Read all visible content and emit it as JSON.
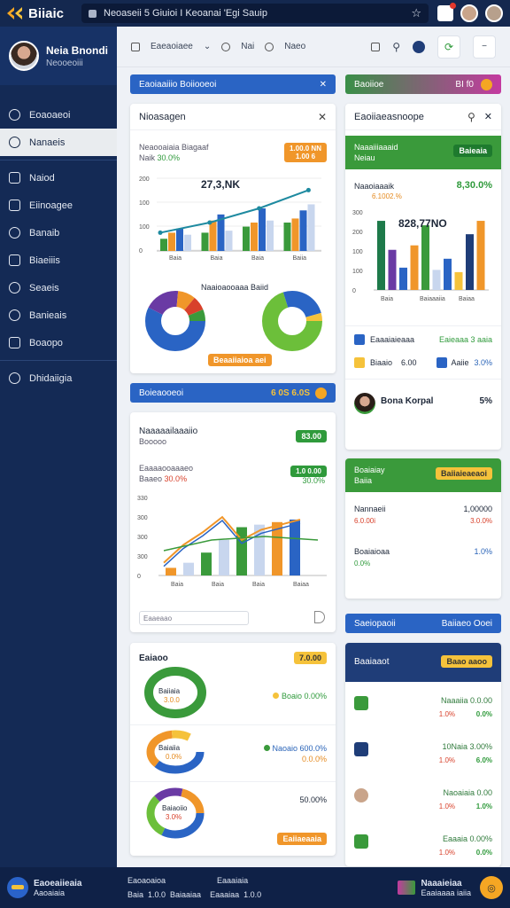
{
  "app": {
    "title": "Biiaic"
  },
  "urlbar": {
    "text": "Neoaseii 5 Giuioi I Keoanai 'Egi Sauip"
  },
  "profile": {
    "name": "Neia Bnondi",
    "sub": "Neooeoiii"
  },
  "sidebar": {
    "items": [
      {
        "label": "Eoaoaeoi"
      },
      {
        "label": "Nanaeis"
      },
      {
        "label": "Naiod"
      },
      {
        "label": "Eiinoagee"
      },
      {
        "label": "Banaib"
      },
      {
        "label": "Biaeiiis"
      },
      {
        "label": "Seaeis"
      },
      {
        "label": "Banieais"
      },
      {
        "label": "Boaopo"
      },
      {
        "label": "Dhidaiigia"
      }
    ]
  },
  "toolbar": {
    "label1": "Eaeaoiaee",
    "label2": "Nai",
    "label3": "Naeo"
  },
  "banners": {
    "blue_top": "Eaoiaaiiio Boiiooeoi",
    "pink_top": "Baoiioe",
    "pink_vals": "BI  f0",
    "blue_mid": "Boieaooeoi",
    "blue_mid_val": "6 0S 6.0S",
    "blue_right": "Saeiopaoii",
    "blue_right_val": "Baiiaeo Ooei"
  },
  "card1": {
    "title": "Nioasagen",
    "subtitle": "Neaooaiaia Biagaaf",
    "subline": "Naik",
    "subline_pct": "30.0%",
    "badge": "1.00.0 NN\n1.00 6",
    "value": "27,3,NK",
    "pie_title": "Naaioaooaaa Baiid",
    "button": "Beaaiiaioa aei"
  },
  "card2": {
    "title": "Eaoiiaeasnoope",
    "head": "Naaaiiiaaaid",
    "head_sub": "Neiau",
    "head_btn": "Baieaia",
    "metric_label": "Naaoiaaaik",
    "metric_pct": "6.1002.%",
    "metric_big": "8,30.0%",
    "value": "828,77NO",
    "row1_label": "Eaaaiaieaaa",
    "row1_val": "Eaieaaa 3 aaia",
    "row2_a": "Biaaio",
    "row2_b": "6.00",
    "row2_c": "Aaiie",
    "row2_d": "3.0%",
    "person_name": "Bona Korpal",
    "person_pct": "5%"
  },
  "card3": {
    "title": "Naaaaailaaaiio",
    "sub": "Booooo",
    "badge": "83.00",
    "label": "Eaaaaooaaaeo",
    "label_sub": "Baaeo",
    "pct": "30.0%",
    "badge2": "1.0 0.00",
    "pct2": "30.0%",
    "search_placeholder": "Eaaeaao"
  },
  "card4": {
    "head": "Boaiaiay",
    "head_sub": "Baiia",
    "btn": "Baiiaieaeaoi",
    "r1_label": "Nannaeii",
    "r1_val": "1,00000",
    "r1_sub": "6.0.00i",
    "r1_pct": "3.0.0%",
    "r2_label": "Boaiaioaa",
    "r2_sub": "0.0%",
    "r2_pct": "1.0%"
  },
  "card5": {
    "title": "Eaiaoo",
    "badge": "7.0.00",
    "r1_in": "Baiiaia",
    "r1_in2": "3.0.0",
    "r1_label": "Boaio 0.00%",
    "r2_in": "Baiaiia",
    "r2_in2": "0.0%",
    "r2_label": "Naoaio 600.0%",
    "r2_pct": "0.0.0%",
    "r3_in": "Baiaoiio",
    "r3_in2": "3.0%",
    "r3_val": "50.00%",
    "r3_btn": "Eaiiaeaaia"
  },
  "card6": {
    "title": "Baaiaaot",
    "btn": "Baao aaoo",
    "rows": [
      {
        "label": "Naaaiia 0.0.00",
        "a": "1.0%",
        "b": "0.0%"
      },
      {
        "label": "10Naia 3.00%",
        "a": "1.0%",
        "b": "6.0%"
      },
      {
        "label": "Naoaiaia 0.00",
        "a": "1.0%",
        "b": "1.0%"
      },
      {
        "label": "Eaaaia 0.00%",
        "a": "1.0%",
        "b": "0.0%"
      }
    ]
  },
  "footer": {
    "brand": "Eaoeaiieaia",
    "brand_sub": "Aaoaiaia",
    "col1": "Eaoaoaioa",
    "col2": "Eaaaiaia",
    "links": "Baia  1.0.0  Baiaaiaa    Eaaaiaa  1.0.0",
    "right": "Naaaieiaa",
    "right_sub": "Eaaiaaaa iaiia"
  },
  "chart_data": [
    {
      "type": "bar",
      "categories": [
        "Baia",
        "Baia",
        "Baia",
        "Baiia"
      ],
      "series": [
        {
          "values": [
            12,
            18,
            24,
            28
          ]
        },
        {
          "values": [
            18,
            30,
            28,
            32
          ]
        },
        {
          "values": [
            22,
            36,
            42,
            40
          ]
        },
        {
          "values": [
            16,
            20,
            30,
            46
          ]
        }
      ],
      "line": [
        18,
        28,
        42,
        60
      ],
      "yticks": [
        "200",
        "100",
        "100",
        "0"
      ]
    },
    {
      "type": "bar",
      "categories": [
        "Baia",
        "Baiaaaiia",
        "Baiaa"
      ],
      "values": [
        62,
        36,
        20,
        40,
        58,
        18,
        28,
        16,
        50,
        62
      ],
      "yticks": [
        "300",
        "200",
        "100",
        "100",
        "0"
      ]
    },
    {
      "type": "line",
      "categories": [
        "Baia",
        "Baia",
        "Baia",
        "Baiaa"
      ],
      "values": [
        10,
        24,
        34,
        46,
        28,
        36,
        40,
        44
      ],
      "yticks": [
        "330",
        "300",
        "300",
        "300",
        "0"
      ]
    }
  ],
  "colors": {
    "navy": "#142a55",
    "green": "#2f9a3b",
    "orange": "#f0962a",
    "blue": "#2a64b8",
    "pink": "#c43aa0"
  }
}
